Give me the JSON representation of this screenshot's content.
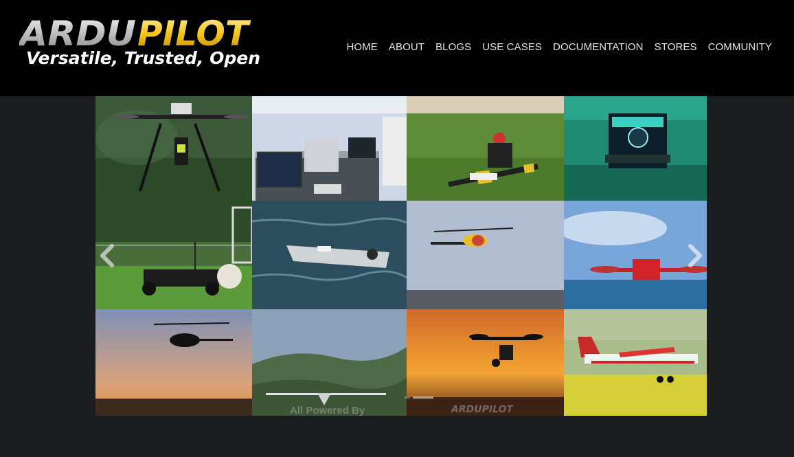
{
  "brand": {
    "logo_text": "ARDUPILOT",
    "tagline": "Versatile, Trusted, Open",
    "colors": {
      "primary": "#cfcfcf",
      "accent": "#f5c518"
    }
  },
  "nav": {
    "items": [
      {
        "label": "HOME"
      },
      {
        "label": "ABOUT"
      },
      {
        "label": "BLOGS"
      },
      {
        "label": "USE CASES"
      },
      {
        "label": "DOCUMENTATION"
      },
      {
        "label": "STORES"
      },
      {
        "label": "COMMUNITY"
      }
    ]
  },
  "carousel": {
    "prev_icon": "chevron-left-icon",
    "next_icon": "chevron-right-icon",
    "overlay_caption": "All Powered By",
    "overlay_logo": "ARDUPILOT",
    "tiles": [
      {
        "subject": "hexacopter"
      },
      {
        "subject": "ground-control-station"
      },
      {
        "subject": "pilot-with-plane"
      },
      {
        "subject": "underwater-rov"
      },
      {
        "subject": "ground-rover"
      },
      {
        "subject": "autonomous-boat"
      },
      {
        "subject": "helicopter-sky"
      },
      {
        "subject": "red-quadcopter"
      },
      {
        "subject": "helicopter-sunset"
      },
      {
        "subject": "fixed-wing-valley"
      },
      {
        "subject": "multicopter-sunset"
      },
      {
        "subject": "red-white-plane"
      }
    ]
  }
}
